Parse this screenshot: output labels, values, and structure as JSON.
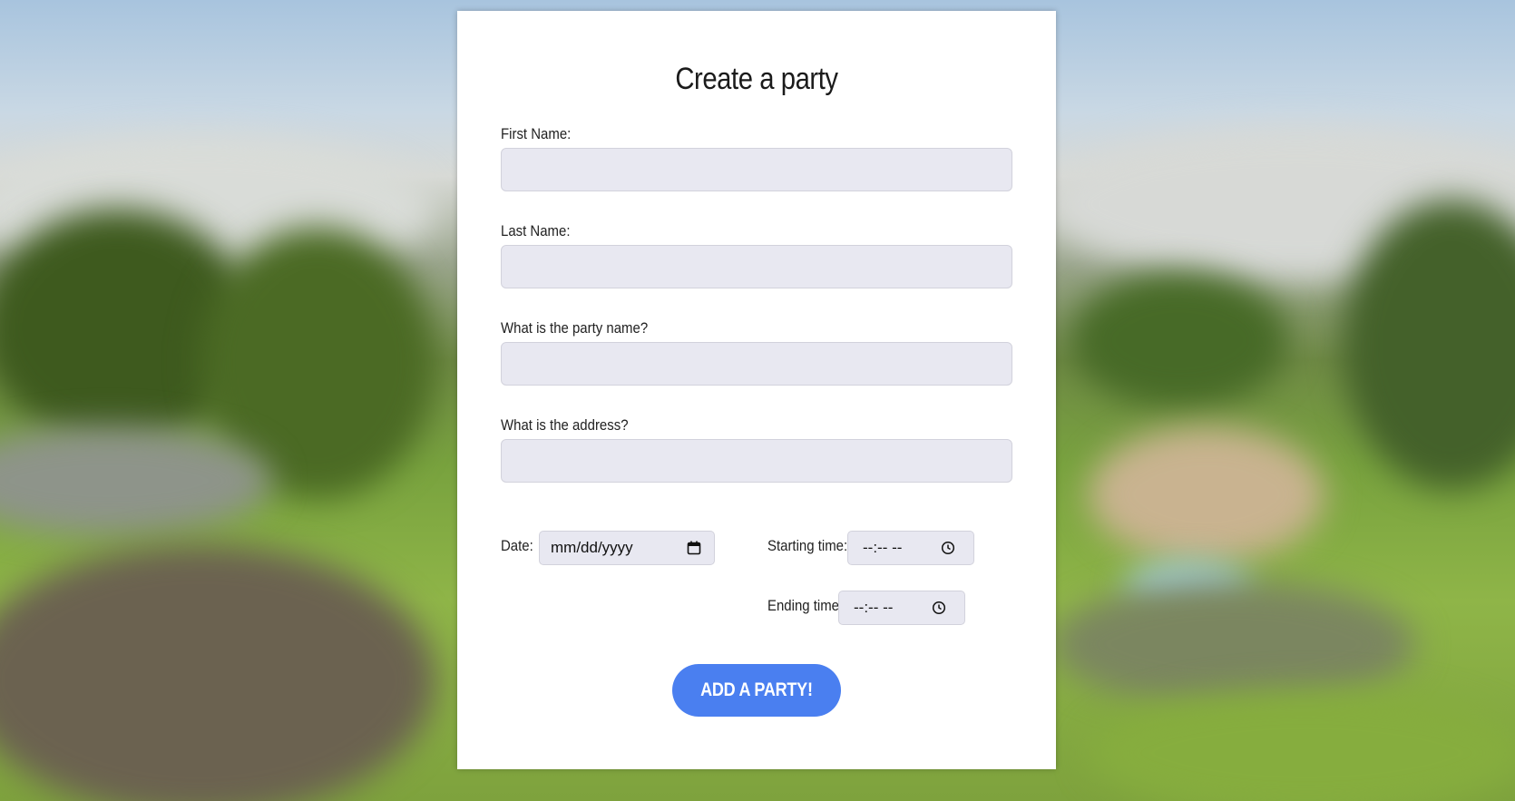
{
  "form": {
    "title": "Create a party",
    "first_name_label": "First Name:",
    "last_name_label": "Last Name:",
    "party_name_label": "What is the party name?",
    "address_label": "What is the address?",
    "first_name_value": "",
    "last_name_value": "",
    "party_name_value": "",
    "address_value": "",
    "date_label": "Date:",
    "date_value": "mm/dd/yyyy",
    "start_time_label": "Starting time:",
    "start_time_value": "--:-- --",
    "end_time_label": "Ending time:",
    "end_time_value": "--:-- --",
    "submit_label": "ADD A PARTY!"
  },
  "icons": {
    "date": "calendar-icon",
    "start_time": "clock-icon",
    "end_time": "clock-icon"
  },
  "colors": {
    "accent": "#4a7ff0",
    "input_bg": "#e8e8f1",
    "card_bg": "#ffffff"
  }
}
